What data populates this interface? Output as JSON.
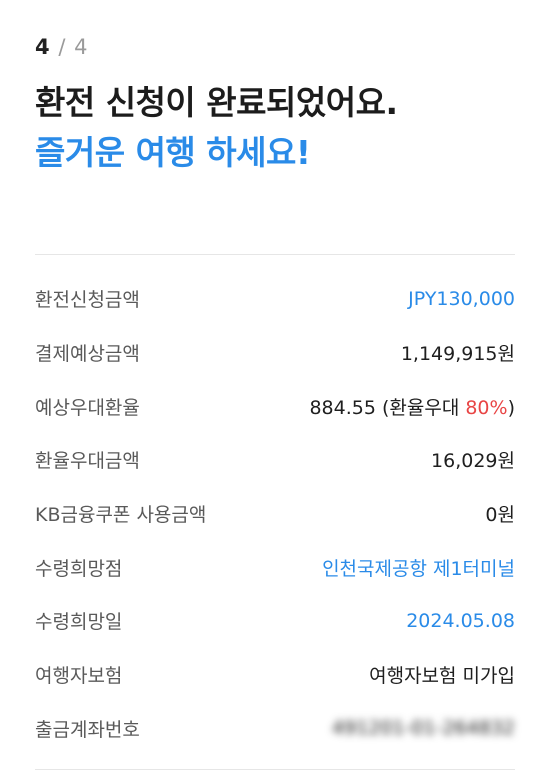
{
  "step": {
    "current": "4",
    "separator": "/",
    "total": "4"
  },
  "headline": {
    "line1": "환전 신청이 완료되었어요.",
    "line2": "즐거운 여행 하세요!"
  },
  "details": {
    "request_amount": {
      "label": "환전신청금액",
      "value": "JPY130,000"
    },
    "expected_payment": {
      "label": "결제예상금액",
      "value": "1,149,915원"
    },
    "preferential_rate": {
      "label": "예상우대환율",
      "rate": "884.55",
      "paren_open": " (환율우대 ",
      "percent": "80%",
      "paren_close": ")"
    },
    "preferential_amount": {
      "label": "환율우대금액",
      "value": "16,029원"
    },
    "coupon_amount": {
      "label": "KB금융쿠폰 사용금액",
      "value": "0원"
    },
    "pickup_location": {
      "label": "수령희망점",
      "value": "인천국제공항 제1터미널"
    },
    "pickup_date": {
      "label": "수령희망일",
      "value": "2024.05.08"
    },
    "insurance": {
      "label": "여행자보험",
      "value": "여행자보험 미가입"
    },
    "account_number": {
      "label": "출금계좌번호",
      "value": "491201-01-264832"
    }
  },
  "colors": {
    "accent_blue": "#2a8be8",
    "highlight_red": "#e84545"
  }
}
